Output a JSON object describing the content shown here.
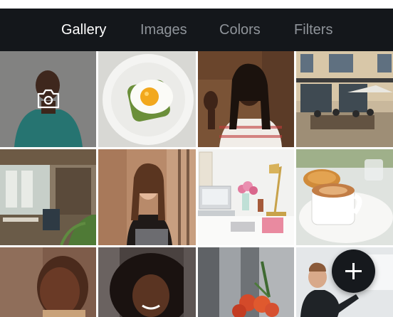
{
  "tabs": [
    {
      "label": "Gallery",
      "active": true
    },
    {
      "label": "Images",
      "active": false
    },
    {
      "label": "Colors",
      "active": false
    },
    {
      "label": "Filters",
      "active": false
    }
  ],
  "colors": {
    "header_background": "#14171b",
    "tab_active": "#ffffff",
    "tab_inactive": "#8f949a",
    "fab_background": "#16191d"
  },
  "gallery": {
    "photos": [
      {
        "subject": "man-grey-backdrop",
        "selected": true
      },
      {
        "subject": "fried-egg-toast"
      },
      {
        "subject": "woman-waving-brick-wall"
      },
      {
        "subject": "street-cafe"
      },
      {
        "subject": "office-interior"
      },
      {
        "subject": "woman-leaning-on-wall"
      },
      {
        "subject": "desk-workspace"
      },
      {
        "subject": "croissant-and-coffee"
      },
      {
        "subject": "woman-portrait"
      },
      {
        "subject": "smiling-woman-curly-hair"
      },
      {
        "subject": "city-buildings-flowers"
      },
      {
        "subject": "man-at-whiteboard"
      }
    ]
  },
  "icons": {
    "selected_overlay": "camera-icon",
    "fab": "plus-icon"
  }
}
